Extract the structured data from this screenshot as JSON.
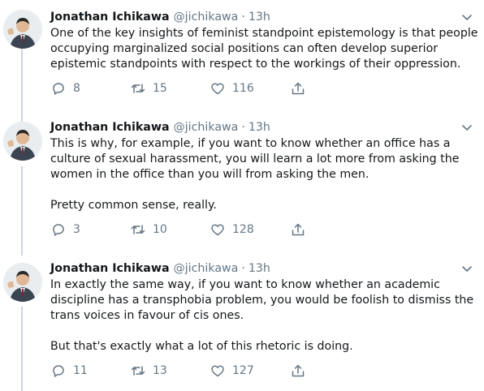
{
  "tweets": [
    {
      "name": "Jonathan Ichikawa",
      "handle": "@jichikawa",
      "separator": "·",
      "time": "13h",
      "paragraphs": [
        "One of the key insights of feminist standpoint epistemology is that people occupying marginalized social positions can often develop superior epistemic standpoints with respect to the workings of their oppression."
      ],
      "replies": "8",
      "retweets": "15",
      "likes": "116"
    },
    {
      "name": "Jonathan Ichikawa",
      "handle": "@jichikawa",
      "separator": "·",
      "time": "13h",
      "paragraphs": [
        "This is why, for example, if you want to know whether an office has a culture of sexual harassment, you will learn a lot more from asking the women in the office than you will from asking the men.",
        "Pretty common sense, really."
      ],
      "replies": "3",
      "retweets": "10",
      "likes": "128"
    },
    {
      "name": "Jonathan Ichikawa",
      "handle": "@jichikawa",
      "separator": "·",
      "time": "13h",
      "paragraphs": [
        "In exactly the same way, if you want to know whether an academic discipline has a transphobia problem, you would be foolish to dismiss the trans voices in favour of cis ones.",
        "But that's exactly what a lot of this rhetoric is doing."
      ],
      "replies": "11",
      "retweets": "13",
      "likes": "127"
    }
  ],
  "icons": {
    "reply": "reply-icon",
    "retweet": "retweet-icon",
    "like": "heart-icon",
    "share": "share-icon",
    "menu": "chevron-down-icon"
  },
  "colors": {
    "text": "#14171a",
    "secondary": "#657786",
    "thread_line": "#ccd6dd"
  }
}
